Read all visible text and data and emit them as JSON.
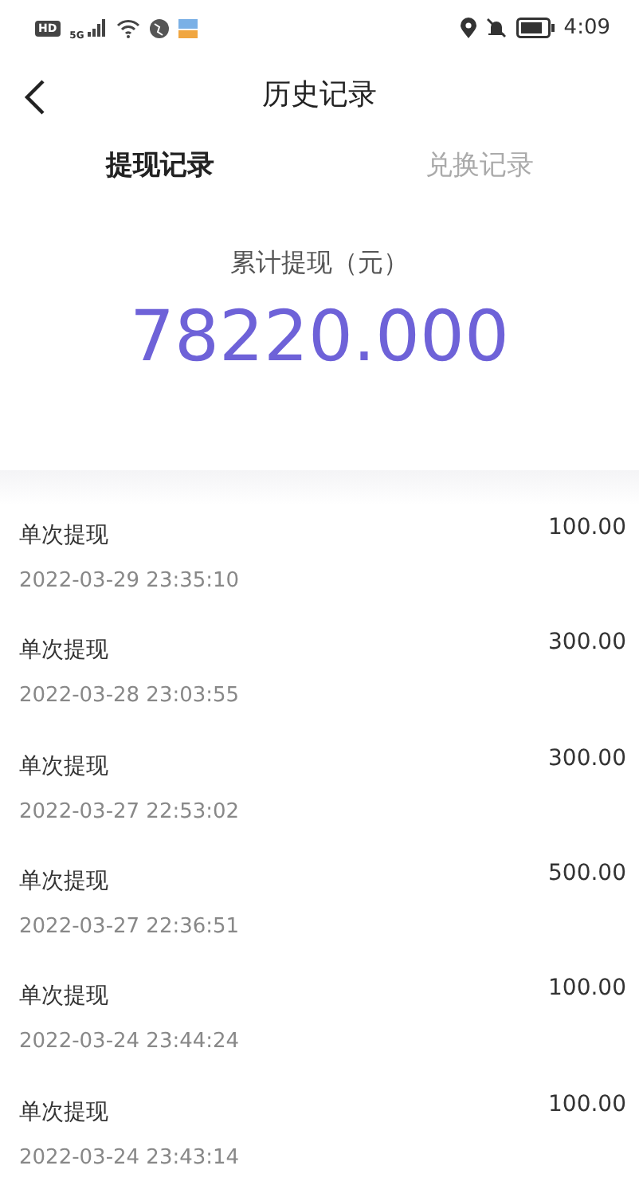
{
  "status_bar": {
    "hd": "HD",
    "network": "5G",
    "time": "4:09"
  },
  "header": {
    "title": "历史记录"
  },
  "tabs": [
    {
      "label": "提现记录",
      "selected": true
    },
    {
      "label": "兑换记录",
      "selected": false
    }
  ],
  "summary": {
    "label": "累计提现（元）",
    "total": "78220.000"
  },
  "records": [
    {
      "title": "单次提现",
      "time": "2022-03-29 23:35:10",
      "amount": "100.00"
    },
    {
      "title": "单次提现",
      "time": "2022-03-28 23:03:55",
      "amount": "300.00"
    },
    {
      "title": "单次提现",
      "time": "2022-03-27 22:53:02",
      "amount": "300.00"
    },
    {
      "title": "单次提现",
      "time": "2022-03-27 22:36:51",
      "amount": "500.00"
    },
    {
      "title": "单次提现",
      "time": "2022-03-24 23:44:24",
      "amount": "100.00"
    },
    {
      "title": "单次提现",
      "time": "2022-03-24 23:43:14",
      "amount": "100.00"
    }
  ]
}
